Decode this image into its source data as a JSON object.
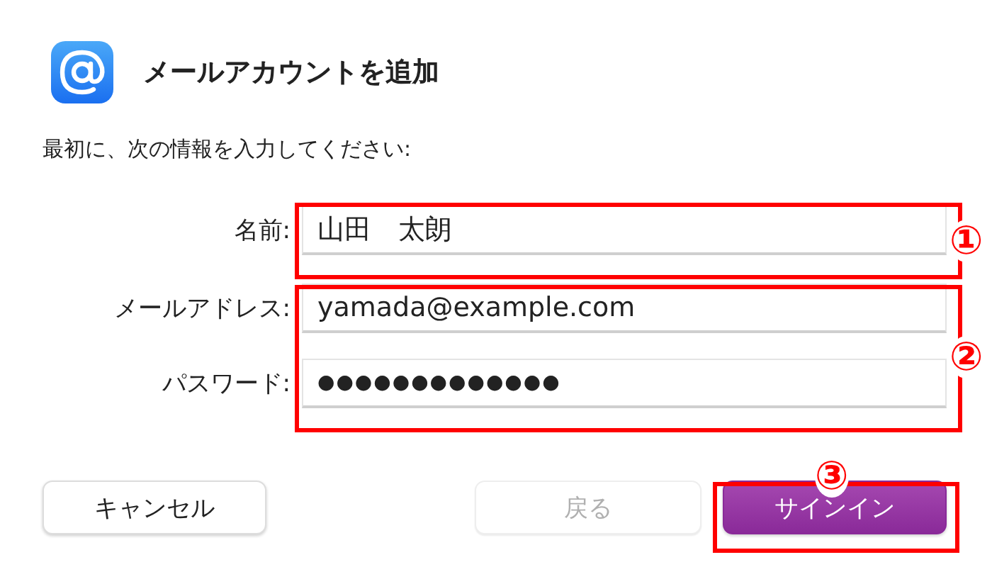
{
  "dialog": {
    "title": "メールアカウントを追加",
    "prompt": "最初に、次の情報を入力してください:"
  },
  "fields": [
    {
      "label": "名前:",
      "value": "山田　太朗"
    },
    {
      "label": "メールアドレス:",
      "value": "yamada@example.com"
    },
    {
      "label": "パスワード:",
      "value": "●●●●●●●●●●●●●"
    }
  ],
  "buttons": [
    {
      "label": "キャンセル",
      "kind": "plain",
      "disabled": false
    },
    {
      "label": "戻る",
      "kind": "plain",
      "disabled": true
    },
    {
      "label": "サインイン",
      "kind": "primary",
      "disabled": false
    }
  ],
  "annotations": [
    {
      "number": "①",
      "kind": "name"
    },
    {
      "number": "②",
      "kind": "credentials"
    },
    {
      "number": "③",
      "kind": "signin"
    }
  ]
}
